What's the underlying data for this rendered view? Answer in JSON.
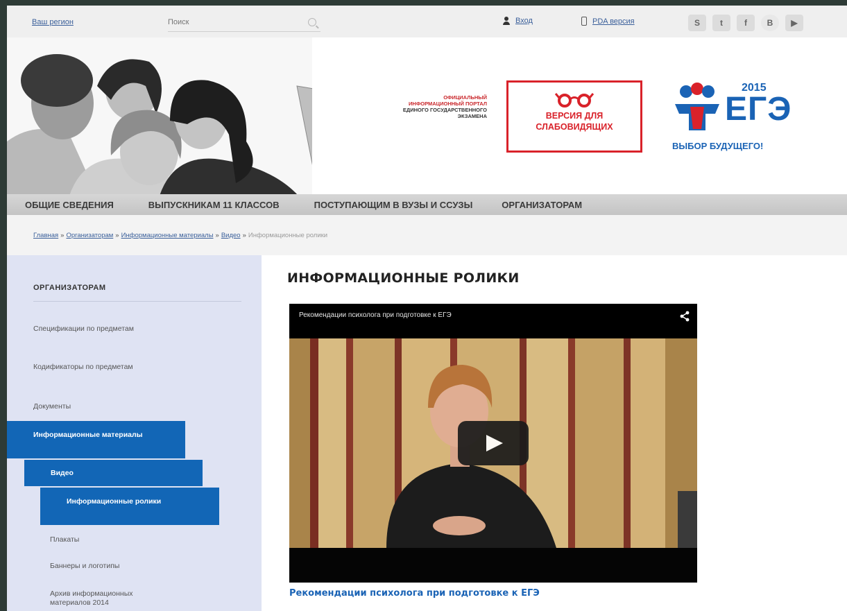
{
  "topbar": {
    "region": "Ваш регион",
    "search_placeholder": "Поиск",
    "login": "Вход",
    "pda": "PDA версия",
    "social": [
      {
        "icon": "skype-icon",
        "glyph": "S"
      },
      {
        "icon": "twitter-icon",
        "glyph": "t"
      },
      {
        "icon": "facebook-icon",
        "glyph": "f"
      },
      {
        "icon": "vkontakte-icon",
        "glyph": "B"
      },
      {
        "icon": "youtube-icon",
        "glyph": "▶"
      }
    ]
  },
  "header": {
    "portal_line1": "ОФИЦИАЛЬНЫЙ",
    "portal_line2": "ИНФОРМАЦИОННЫЙ ПОРТАЛ",
    "portal_line3": "ЕДИНОГО ГОСУДАРСТВЕННОГО",
    "portal_line4": "ЭКЗАМЕНА",
    "low_vision_line1": "ВЕРСИЯ ДЛЯ",
    "low_vision_line2": "СЛАБОВИДЯЩИХ",
    "logo_year": "2015",
    "logo_word": "ЕГЭ",
    "logo_tagline": "ВЫБОР БУДУЩЕГО!",
    "accent_red": "#d9222a",
    "accent_blue": "#1a63b5"
  },
  "nav": {
    "items": [
      "ОБЩИЕ СВЕДЕНИЯ",
      "ВЫПУСКНИКАМ 11 КЛАССОВ",
      "ПОСТУПАЮЩИМ В ВУЗЫ И ССУЗЫ",
      "ОРГАНИЗАТОРАМ"
    ]
  },
  "breadcrumb": {
    "items": [
      "Главная",
      "Организаторам",
      "Информационные материалы",
      "Видео"
    ],
    "separator": "»",
    "current": "Информационные ролики"
  },
  "sidebar": {
    "title": "ОРГАНИЗАТОРАМ",
    "items": [
      "Спецификации по предметам",
      "Кодификаторы по предметам",
      "Документы",
      "Информационные материалы",
      "Видео",
      "Информационные ролики",
      "Плакаты",
      "Баннеры и логотипы",
      "Архив информационных материалов 2014"
    ],
    "active_color": "#1266b6"
  },
  "main": {
    "title": "ИНФОРМАЦИОННЫЕ РОЛИКИ",
    "video_title": "Рекомендации психолога при подготовке к ЕГЭ",
    "video_caption": "Рекомендации психолога при подготовке к ЕГЭ"
  }
}
